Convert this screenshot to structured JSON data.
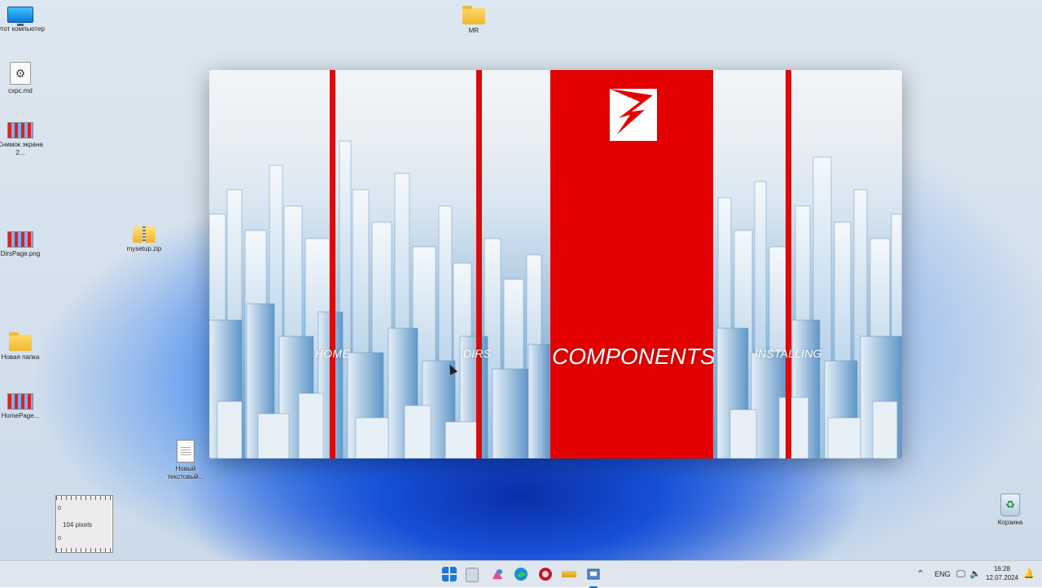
{
  "desktop_icons": [
    {
      "name": "this-pc",
      "label": "Этот компьютер"
    },
    {
      "name": "cfg-file",
      "label": "cxpc.md"
    },
    {
      "name": "screenshot",
      "label": "Снимок экрана 2..."
    },
    {
      "name": "dirspage",
      "label": "DirsPage.png"
    },
    {
      "name": "mysetup",
      "label": "mysetup.zip"
    },
    {
      "name": "new-folder",
      "label": "Новая папка"
    },
    {
      "name": "homepage",
      "label": "HomePage..."
    },
    {
      "name": "new-text",
      "label": "Новый текстовый..."
    },
    {
      "name": "mr-folder",
      "label": "MR"
    },
    {
      "name": "recycle-bin",
      "label": "Корзина"
    }
  ],
  "installer": {
    "nav": {
      "home": "HOME",
      "dirs": "DIRS",
      "components": "COMPONENTS",
      "installing": "INSTALLING"
    },
    "active_tab": "COMPONENTS",
    "accent_color": "#e30000"
  },
  "ruler": {
    "measure": "104 pixels",
    "zero_top": "0",
    "zero_bottom": "0"
  },
  "taskbar": {
    "language": "ENG",
    "time": "16:28",
    "date": "12.07.2024",
    "apps": [
      "start-icon",
      "notepad-icon",
      "paint-icon",
      "edge-icon",
      "app-red-icon",
      "ruler-app-icon",
      "installer-icon"
    ]
  }
}
